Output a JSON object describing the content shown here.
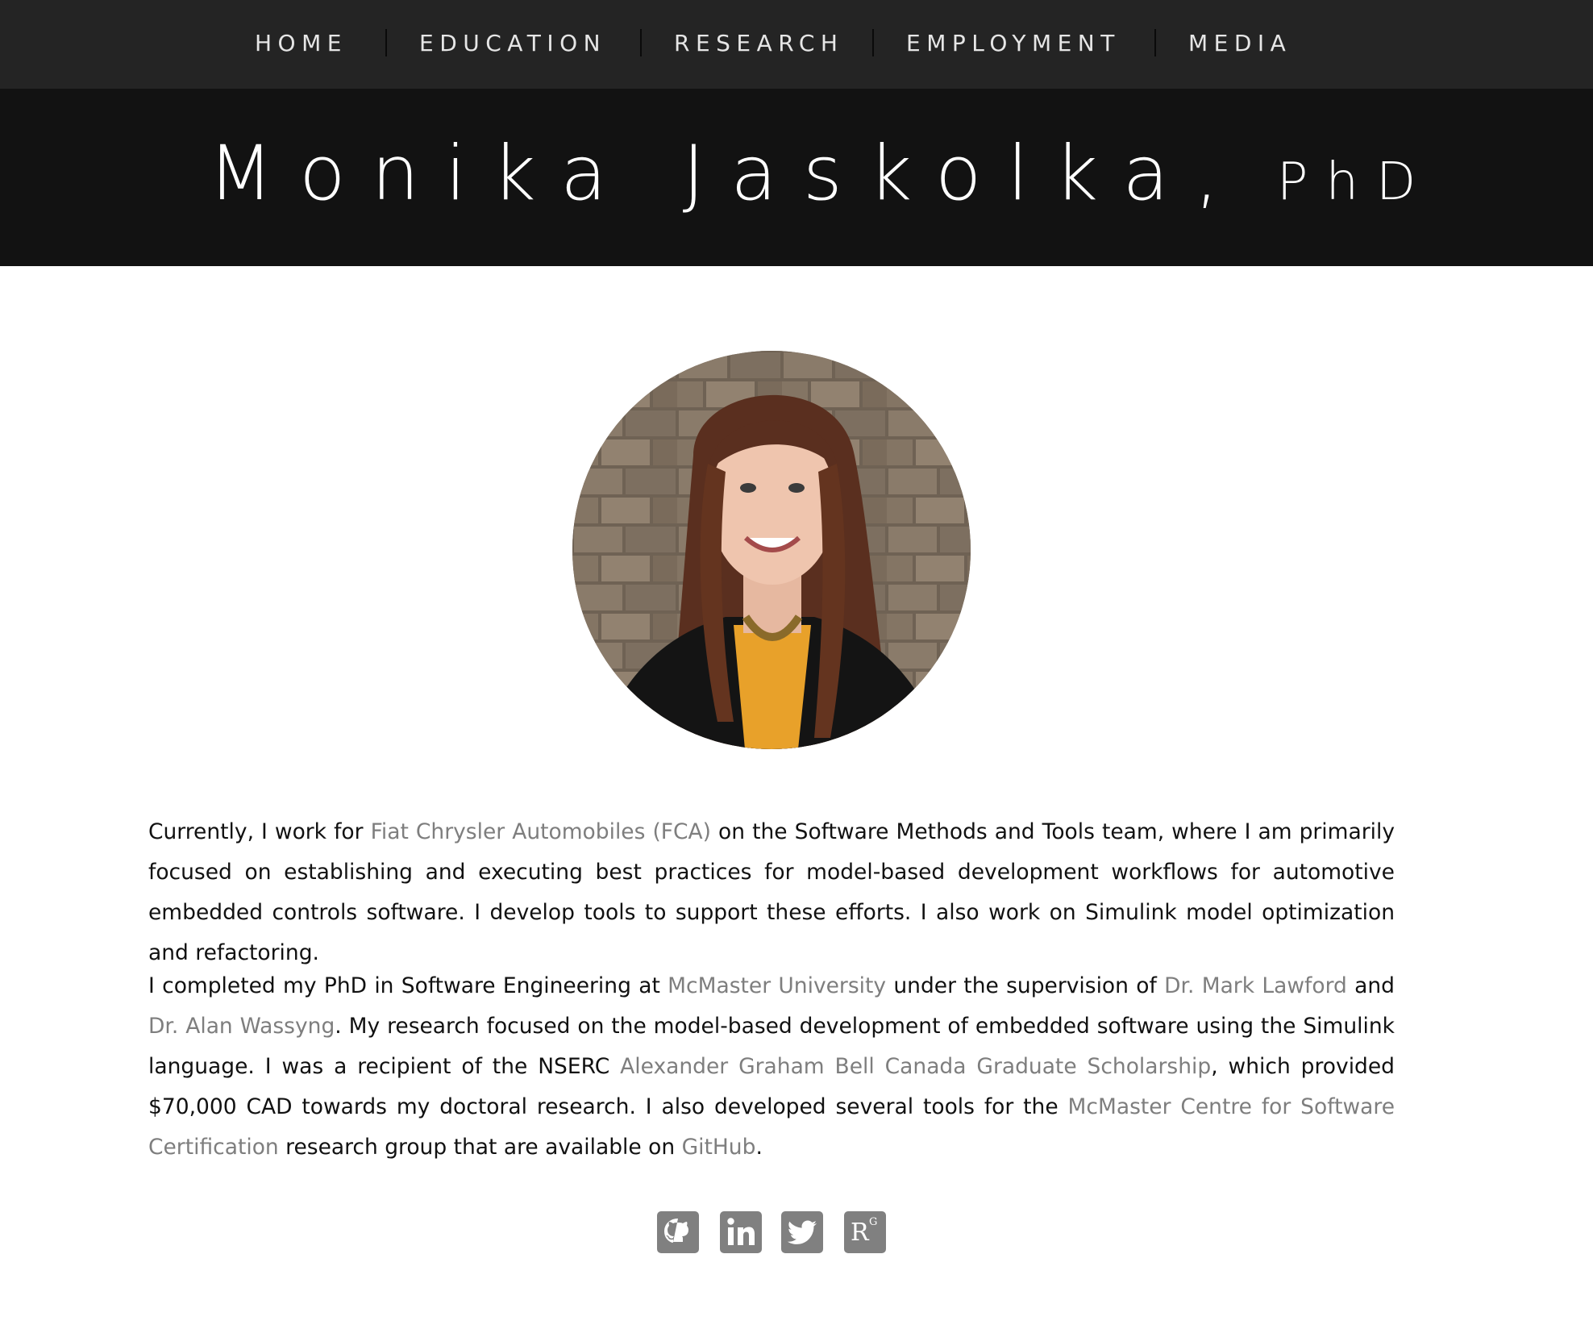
{
  "nav": {
    "items": [
      {
        "label": "HOME"
      },
      {
        "label": "EDUCATION"
      },
      {
        "label": "RESEARCH"
      },
      {
        "label": "EMPLOYMENT"
      },
      {
        "label": "MEDIA"
      }
    ],
    "background": "#242424",
    "separator_color": "#0a0a0a"
  },
  "header": {
    "name": "Monika Jaskolka,",
    "suffix": "PhD",
    "background": "#121212"
  },
  "portrait": {
    "description_icon": "profile-photo"
  },
  "bio": {
    "p1": {
      "t1": "Currently, I work for ",
      "link_fca": "Fiat Chrysler Automobiles (FCA)",
      "t2": " on the Software Methods and Tools team, where I am primarily focused on establishing and executing best practices for model-based development workflows for automotive embedded controls software. I develop tools to support these efforts. I also work on Simulink model optimization and refactoring."
    },
    "p2": {
      "t1": "I completed my PhD in Software Engineering at ",
      "link_mcmaster": "McMaster University",
      "t2": " under the supervision of ",
      "link_lawford": "Dr. Mark Lawford",
      "t3": " and ",
      "link_wassyng": "Dr. Alan Wassyng",
      "t4": ". My research focused on the model-based development of embedded software using the Simulink language. I was a recipient of the NSERC ",
      "link_scholarship": "Alexander Graham Bell Canada Graduate Scholarship",
      "t5": ", which provided $70,000 CAD towards my doctoral research. I also developed several tools for the ",
      "link_mcscert": "McMaster Centre for Software Certification",
      "t6": " research group that are available on ",
      "link_github": "GitHub",
      "t7": "."
    },
    "link_color": "#7e7e7e",
    "text_color": "#111111"
  },
  "social": {
    "icons": [
      "github-icon",
      "linkedin-icon",
      "twitter-icon",
      "researchgate-icon"
    ],
    "researchgate_letter": "R",
    "researchgate_sup": "G",
    "color": "#808080"
  }
}
